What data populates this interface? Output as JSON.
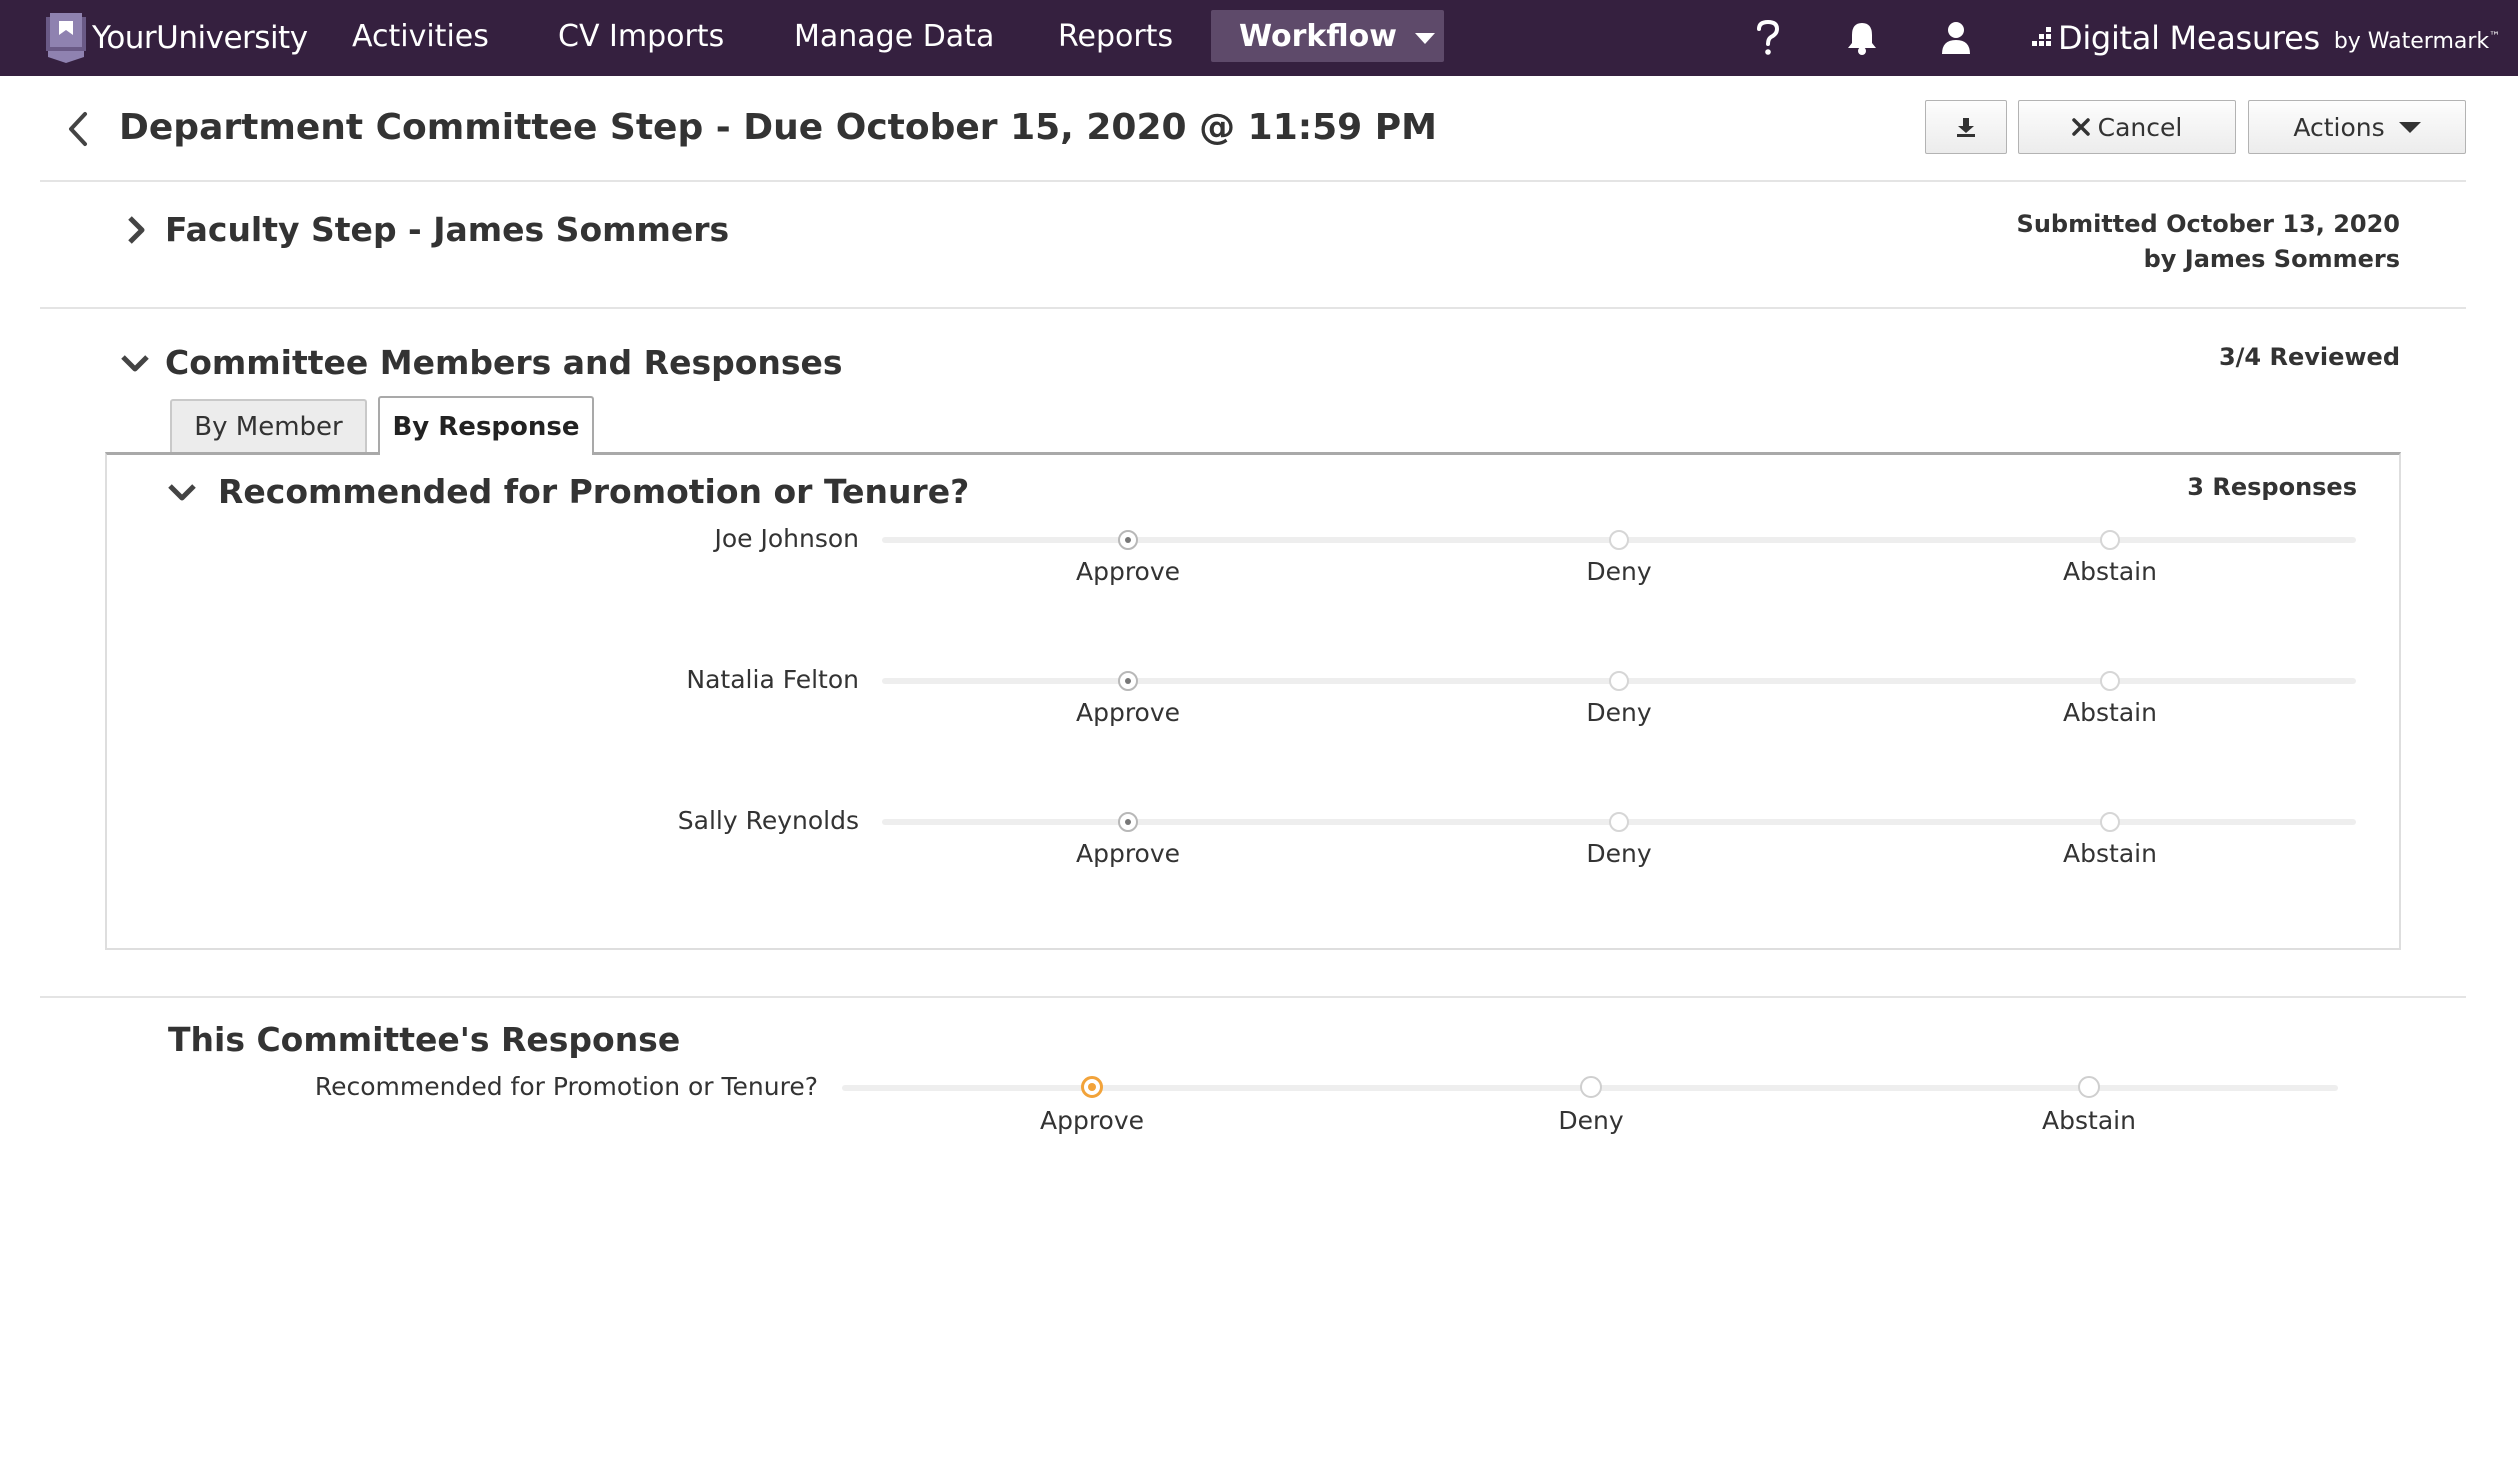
{
  "nav": {
    "brand": "YourUniversity",
    "items": [
      {
        "label": "Activities",
        "name": "nav-activities"
      },
      {
        "label": "CV Imports",
        "name": "nav-cv-imports"
      },
      {
        "label": "Manage Data",
        "name": "nav-manage-data"
      },
      {
        "label": "Reports",
        "name": "nav-reports"
      }
    ],
    "active": "Workflow",
    "icons": [
      "help-icon",
      "bell-icon",
      "user-icon"
    ],
    "vendor": {
      "name": "Digital Measures",
      "by": "by Watermark",
      "tm": "™"
    }
  },
  "header": {
    "title": "Department Committee Step - Due October 15, 2020 @ 11:59 PM",
    "cancel_label": "Cancel",
    "actions_label": "Actions"
  },
  "faculty_step": {
    "title": "Faculty Step - James Sommers",
    "submitted_line1": "Submitted October 13, 2020",
    "submitted_line2": "by James Sommers",
    "expanded": false
  },
  "committee": {
    "title": "Committee Members and Responses",
    "reviewed": "3/4 Reviewed",
    "tabs": [
      {
        "label": "By Member",
        "active": false
      },
      {
        "label": "By Response",
        "active": true
      }
    ],
    "question": {
      "title": "Recommended for Promotion or Tenure?",
      "count": "3 Responses",
      "options": [
        "Approve",
        "Deny",
        "Abstain"
      ],
      "responses": [
        {
          "member": "Joe Johnson",
          "choice": "Approve"
        },
        {
          "member": "Natalia Felton",
          "choice": "Approve"
        },
        {
          "member": "Sally Reynolds",
          "choice": "Approve"
        }
      ]
    }
  },
  "this_response": {
    "title": "This Committee's Response",
    "question": "Recommended for Promotion or Tenure?",
    "options": [
      "Approve",
      "Deny",
      "Abstain"
    ],
    "selected": "Approve",
    "accent": "#f2a33a"
  },
  "colors": {
    "nav_bg": "#35203f",
    "nav_active_bg": "#5e4a6a"
  }
}
